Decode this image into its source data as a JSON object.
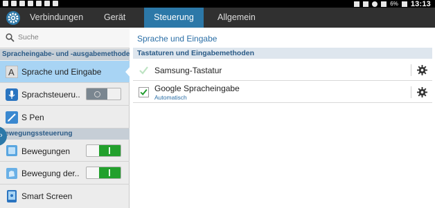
{
  "status_bar": {
    "battery": "6%",
    "time": "13:13"
  },
  "tabs": [
    {
      "label": "Verbindungen",
      "selected": false
    },
    {
      "label": "Gerät",
      "selected": false
    },
    {
      "label": "Steuerung",
      "selected": true
    },
    {
      "label": "Allgemein",
      "selected": false
    }
  ],
  "sidebar": {
    "search_placeholder": "Suche",
    "sections": [
      {
        "title": "Spracheingabe- und -ausgabemethoden"
      },
      {
        "title": "Bewegungssteuerung"
      }
    ],
    "items": [
      {
        "label": "Sprache und Eingabe",
        "icon": "language-a-icon",
        "selected": true
      },
      {
        "label": "Sprachsteueru..",
        "icon": "voice-control-icon",
        "toggle": false
      },
      {
        "label": "S Pen",
        "icon": "s-pen-icon"
      },
      {
        "label": "Bewegungen",
        "icon": "motion-icon",
        "toggle": true
      },
      {
        "label": "Bewegung der..",
        "icon": "palm-motion-icon",
        "toggle": true
      },
      {
        "label": "Smart Screen",
        "icon": "smart-screen-icon"
      }
    ]
  },
  "main": {
    "title": "Sprache und Eingabe",
    "section": "Tastaturen und Eingabemethoden",
    "rows": [
      {
        "title": "Samsung-Tastatur",
        "checked": true,
        "disabled": true
      },
      {
        "title": "Google Spracheingabe",
        "subtitle": "Automatisch",
        "checked": true
      }
    ]
  },
  "colors": {
    "tab_selected": "#2c78a8",
    "item_selected": "#a8d4f4",
    "toggle_on": "#22a02c",
    "accent_text": "#2a6ea6"
  }
}
